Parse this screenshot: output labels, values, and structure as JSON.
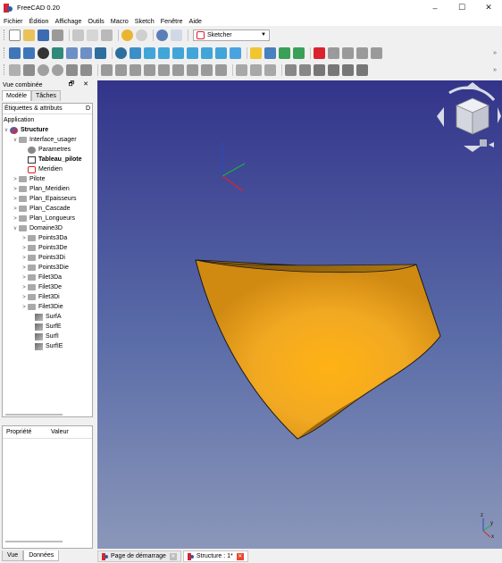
{
  "window": {
    "title": "FreeCAD 0.20",
    "controls": [
      "–",
      "☐",
      "✕"
    ]
  },
  "menu": [
    "Fichier",
    "Édition",
    "Affichage",
    "Outils",
    "Macro",
    "Sketch",
    "Fenêtre",
    "Aide"
  ],
  "toolbar": {
    "workbench": "Sketcher",
    "more": "»"
  },
  "combo_view": {
    "title": "Vue combinée",
    "header_buttons": "🗗 ✕",
    "tabs": [
      "Modèle",
      "Tâches"
    ],
    "tree_header": {
      "label": "Étiquettes & attributs",
      "col2": "D"
    },
    "root_label": "Application",
    "items": [
      {
        "label": "Structure",
        "bold": true
      },
      {
        "label": "Interface_usager"
      },
      {
        "label": "Parametres"
      },
      {
        "label": "Tableau_pilote",
        "bold": true
      },
      {
        "label": "Meridien"
      },
      {
        "label": "Pilote"
      },
      {
        "label": "Plan_Meridien"
      },
      {
        "label": "Plan_Epaisseurs"
      },
      {
        "label": "Plan_Cascade"
      },
      {
        "label": "Plan_Longueurs"
      },
      {
        "label": "Domaine3D"
      },
      {
        "label": "Points3Da"
      },
      {
        "label": "Points3De"
      },
      {
        "label": "Points3Di"
      },
      {
        "label": "Points3Die"
      },
      {
        "label": "Filet3Da"
      },
      {
        "label": "Filet3De"
      },
      {
        "label": "Filet3Di"
      },
      {
        "label": "Filet3Die"
      },
      {
        "label": "SurfA"
      },
      {
        "label": "SurfE"
      },
      {
        "label": "SurfI"
      },
      {
        "label": "SurfIE"
      }
    ]
  },
  "properties": {
    "col_property": "Propriété",
    "col_value": "Valeur"
  },
  "bottom_tabs": [
    "Vue",
    "Données"
  ],
  "doc_tabs": [
    {
      "label": "Page de démarrage",
      "active": false
    },
    {
      "label": "Structure : 1*",
      "active": true
    }
  ],
  "axis_labels": {
    "x": "x",
    "y": "y",
    "z": "z"
  },
  "colors": {
    "surface": "#f2a922",
    "surface_dark": "#8a5a08",
    "view_top": "#33348a",
    "view_bottom": "#8b97b9",
    "accent": "#d9232e"
  }
}
